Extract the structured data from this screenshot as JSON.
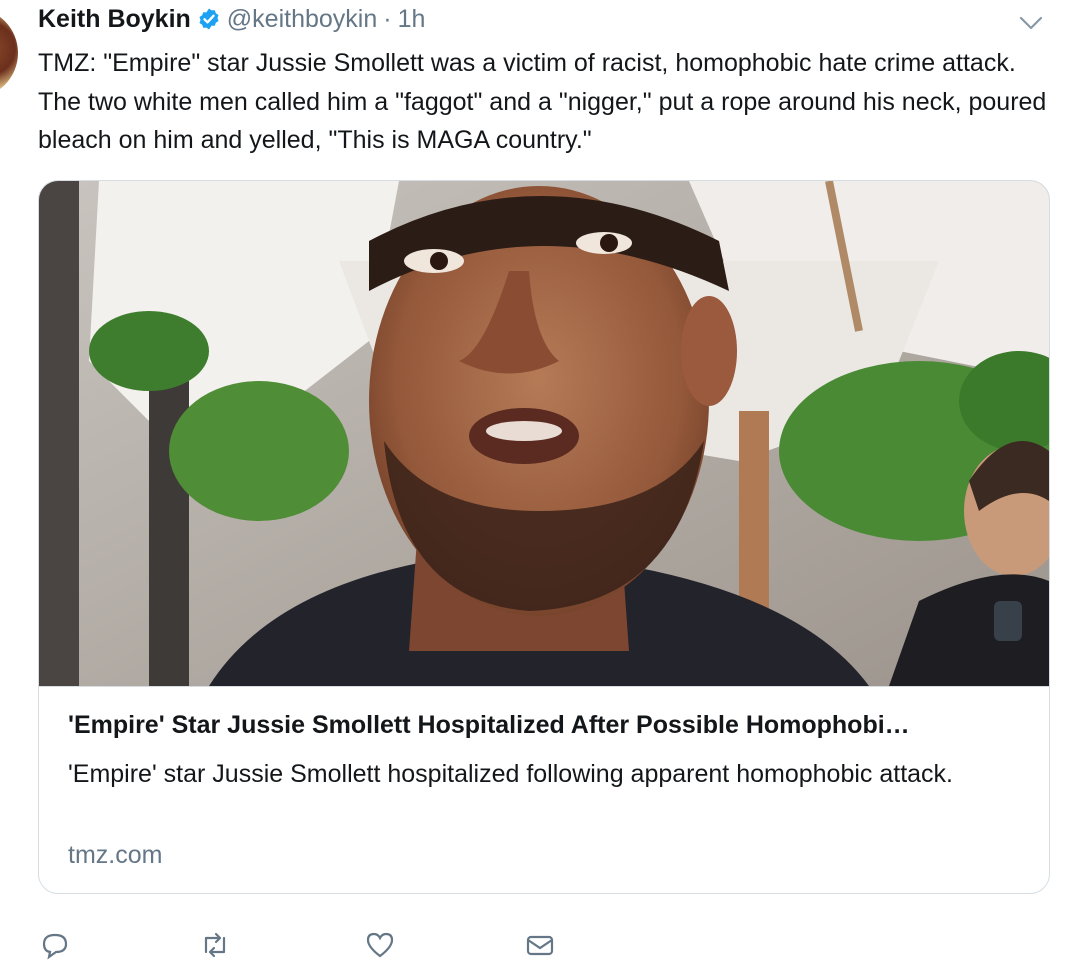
{
  "tweet": {
    "author": {
      "name": "Keith Boykin",
      "handle": "@keithboykin",
      "verified": true
    },
    "separator": "·",
    "time": "1h",
    "text": "TMZ: \"Empire\" star Jussie Smollett was a victim of racist, homophobic hate crime attack. The two white men called him a \"faggot\" and a \"nigger,\" put a rope around his neck, poured bleach on him and yelled, \"This is MAGA country.\"",
    "card": {
      "title": "'Empire' Star Jussie Smollett Hospitalized After Possible Homophobi…",
      "description": "'Empire' star Jussie Smollett hospitalized following apparent homophobic attack.",
      "domain": "tmz.com"
    },
    "actions": {
      "reply_icon": "reply-icon",
      "retweet_icon": "retweet-icon",
      "like_icon": "heart-icon",
      "dm_icon": "message-icon"
    }
  },
  "colors": {
    "text": "#14171a",
    "secondary": "#657786",
    "verified": "#1da1f2",
    "border": "#d5dde3"
  }
}
